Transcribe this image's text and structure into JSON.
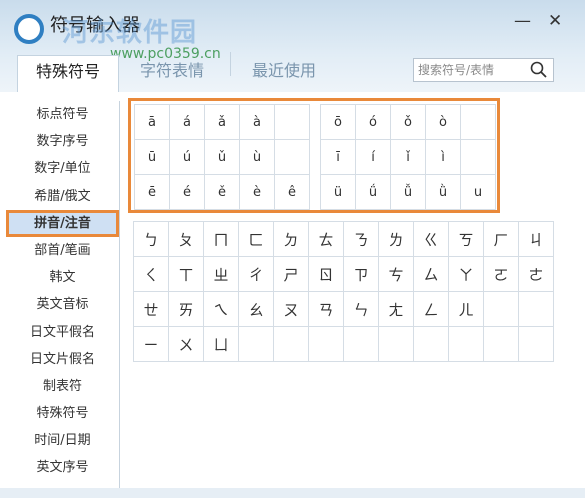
{
  "window": {
    "title": "符号输入器",
    "watermark": "河东软件园",
    "watermark_url": "www.pc0359.cn",
    "minimize": "—",
    "close": "✕"
  },
  "tabs": [
    "特殊符号",
    "字符表情",
    "最近使用"
  ],
  "search": {
    "placeholder": "搜索符号/表情"
  },
  "sidebar": {
    "items": [
      "标点符号",
      "数字序号",
      "数字/单位",
      "希腊/俄文",
      "拼音/注音",
      "部首/笔画",
      "韩文",
      "英文音标",
      "日文平假名",
      "日文片假名",
      "制表符",
      "特殊符号",
      "时间/日期",
      "英文序号"
    ],
    "active": "拼音/注音"
  },
  "pinyin_left": [
    "ā",
    "á",
    "ǎ",
    "à",
    "",
    "ū",
    "ú",
    "ǔ",
    "ù",
    "",
    "ē",
    "é",
    "ě",
    "è",
    "ê"
  ],
  "pinyin_right": [
    "ō",
    "ó",
    "ǒ",
    "ò",
    "",
    "ī",
    "í",
    "ǐ",
    "ì",
    "",
    "ü",
    "ǘ",
    "ǚ",
    "ǜ",
    "u"
  ],
  "bopomofo": [
    "ㄅ",
    "ㄆ",
    "ㄇ",
    "ㄈ",
    "ㄉ",
    "ㄊ",
    "ㄋ",
    "ㄌ",
    "ㄍ",
    "ㄎ",
    "ㄏ",
    "ㄐ",
    "ㄑ",
    "ㄒ",
    "ㄓ",
    "ㄔ",
    "ㄕ",
    "ㄖ",
    "ㄗ",
    "ㄘ",
    "ㄙ",
    "ㄚ",
    "ㄛ",
    "ㄜ",
    "ㄝ",
    "ㄞ",
    "ㄟ",
    "ㄠ",
    "ㄡ",
    "ㄢ",
    "ㄣ",
    "ㄤ",
    "ㄥ",
    "ㄦ",
    "",
    "",
    "ㄧ",
    "ㄨ",
    "ㄩ",
    "",
    "",
    "",
    "",
    "",
    "",
    "",
    "",
    ""
  ]
}
